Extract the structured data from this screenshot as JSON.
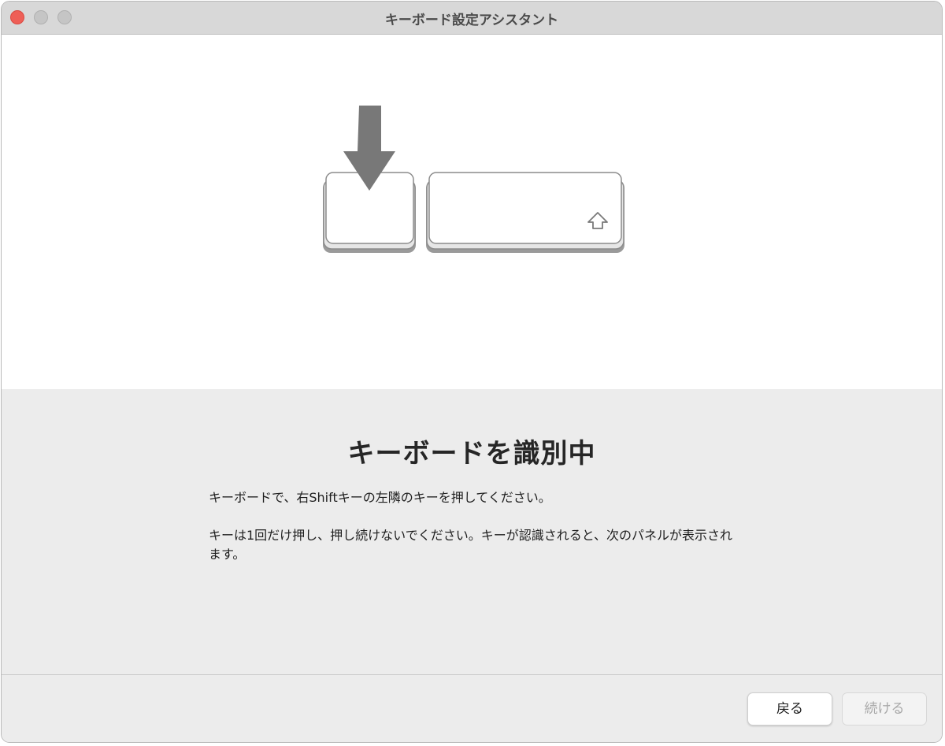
{
  "window": {
    "title": "キーボード設定アシスタント"
  },
  "illustration": {
    "icons": [
      "down-arrow-icon",
      "shift-arrow-icon"
    ]
  },
  "main": {
    "heading": "キーボードを識別中",
    "instruction": "キーボードで、右Shiftキーの左隣のキーを押してください。",
    "note": "キーは1回だけ押し、押し続けないでください。キーが認識されると、次のパネルが表示されます。"
  },
  "footer": {
    "back_label": "戻る",
    "continue_label": "続ける"
  },
  "colors": {
    "close_button": "#ee5f57",
    "titlebar": "#d8d8d8",
    "panel_background": "#ececec",
    "disabled_text": "#a8a8a8"
  }
}
